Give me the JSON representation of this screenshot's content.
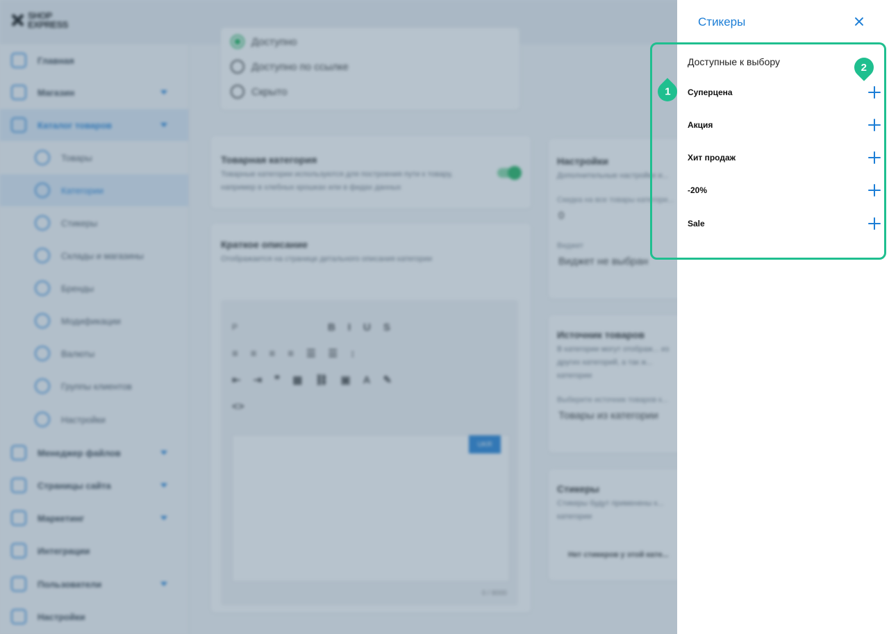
{
  "app": {
    "logo_line1": "SHOP",
    "logo_line2": "EXPRESS"
  },
  "sidebar": {
    "items": [
      {
        "label": "Главная",
        "icon": "home-icon"
      },
      {
        "label": "Магазин",
        "icon": "cart-icon"
      },
      {
        "label": "Каталог товаров",
        "icon": "book-icon"
      },
      {
        "label": "Товары",
        "icon": "box-icon"
      },
      {
        "label": "Категории",
        "icon": "categories-icon"
      },
      {
        "label": "Стикеры",
        "icon": "sticker-icon"
      },
      {
        "label": "Склады и магазины",
        "icon": "warehouse-icon"
      },
      {
        "label": "Бренды",
        "icon": "tag-icon"
      },
      {
        "label": "Модификации",
        "icon": "bookmark-icon"
      },
      {
        "label": "Валюты",
        "icon": "dollar-icon"
      },
      {
        "label": "Группы клиентов",
        "icon": "users-icon"
      },
      {
        "label": "Настройки",
        "icon": "gear-icon"
      },
      {
        "label": "Менеджер файлов",
        "icon": "folder-icon"
      },
      {
        "label": "Страницы сайта",
        "icon": "page-icon"
      },
      {
        "label": "Маркетинг",
        "icon": "marketing-icon"
      },
      {
        "label": "Интеграции",
        "icon": "megaphone-icon"
      },
      {
        "label": "Пользователи",
        "icon": "user-icon"
      },
      {
        "label": "Настройки",
        "icon": "gear-icon"
      }
    ]
  },
  "main": {
    "visibility_options": [
      "Доступно",
      "Доступно по ссылке",
      "Скрыто"
    ],
    "category_card": {
      "title": "Товарная категория",
      "subtitle": "Товарные категории используются для построения пути к товару, например в хлебных крошках или в фидах данных"
    },
    "short_desc_card": {
      "title": "Краткое описание",
      "subtitle": "Отображается на странице детального описания категории"
    },
    "editor": {
      "format_value": "P",
      "lang_button": "UKR",
      "counter": "0 / 8000"
    },
    "settings_card": {
      "title": "Настройки",
      "subtitle": "Дополнительные настройки и...",
      "discount_label": "Скидка на все товары категори...",
      "discount_value": "0",
      "widget_label": "Виджет",
      "widget_value": "Виджет не выбран"
    },
    "source_card": {
      "title": "Источник товаров",
      "subtitle": "В категории могут отображ... из других категорий, а так ж... категории",
      "select_label": "Выберите источник товаров к...",
      "select_value": "Товары из категории"
    },
    "stickers_card": {
      "title": "Стикеры",
      "subtitle": "Стикеры будут применены к... категории",
      "empty_text": "Нет стикеров у этой кате..."
    }
  },
  "drawer": {
    "title": "Стикеры",
    "section_label": "Доступные к выбору",
    "stickers": [
      {
        "name": "Суперцена"
      },
      {
        "name": "Акция"
      },
      {
        "name": "Хит продаж"
      },
      {
        "name": "-20%"
      },
      {
        "name": "Sale"
      }
    ],
    "markers": [
      "1",
      "2"
    ],
    "accent_color": "#1c7ed6",
    "highlight_color": "#1fbf8f"
  }
}
